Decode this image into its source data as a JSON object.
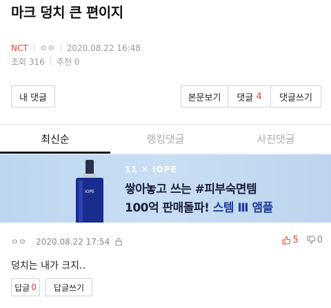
{
  "post": {
    "title": "마크 덩치 큰 편이지",
    "category": "NCT",
    "author": "ㅇㅇ",
    "datetime": "2020.08.22 16:48",
    "views": "조회 316",
    "recommend": "추천 0"
  },
  "actions": {
    "my_comments": "내 댓글",
    "view_body": "본문보기",
    "comments_label": "댓글",
    "comments_count": "4",
    "write_comment": "댓글쓰기"
  },
  "tabs": [
    "최신순",
    "랭킹댓글",
    "사진댓글"
  ],
  "banner": {
    "brand": "11 ✕ IOPE",
    "line1": "쌓아놓고 쓰는 #피부숙면템",
    "line2_a": "100억 판매돌파!",
    "line2_b": "스템 Ⅲ 앰플",
    "bottle_label": "IOPE",
    "colors": {
      "bg": "#c2d9f1",
      "bottle": "#1b2c8f"
    }
  },
  "comment": {
    "author": "ㅇㅇ",
    "datetime": "2020.08.22 17:54",
    "upvotes": "5",
    "downvotes": "0",
    "body": "덩치는 내가 크지..",
    "reply_label": "답글",
    "reply_count": "0",
    "reply_write": "답글쓰기"
  },
  "colors": {
    "accent": "#e8412c",
    "muted": "#999999"
  }
}
